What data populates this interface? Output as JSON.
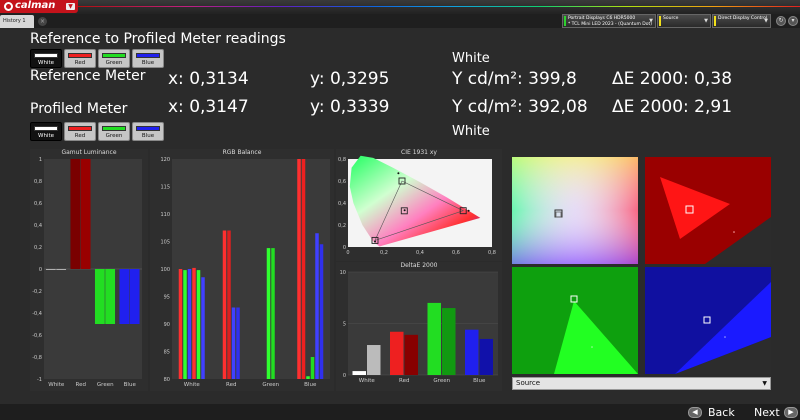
{
  "app": {
    "logo_text": "calman"
  },
  "tabs": {
    "history_label": "History 1",
    "close_glyph": "×"
  },
  "devices": {
    "display_line1": "Portrait Displays C6 HDR5000",
    "display_line2": "* TCL Mini LED 2023 - (Quantum Dot)",
    "source": "Source",
    "control": "Direct Display Control"
  },
  "readings": {
    "title": "Reference to Profiled Meter readings",
    "white_top": "White",
    "white_bottom": "White",
    "swatches": [
      "White",
      "Red",
      "Green",
      "Blue"
    ],
    "swatch_colors": [
      "#ffffff",
      "#ee2020",
      "#22dd22",
      "#2020ee"
    ],
    "reference": {
      "label": "Reference Meter",
      "x": "x: 0,3134",
      "y": "y: 0,3295",
      "Y": "Y cd/m²: 399,8",
      "dE": "ΔE 2000: 0,38"
    },
    "profiled": {
      "label": "Profiled Meter",
      "x": "x: 0,3147",
      "y": "y: 0,3339",
      "Y": "Y cd/m²: 392,08",
      "dE": "ΔE 2000: 2,91"
    }
  },
  "chart_data": [
    {
      "type": "bar",
      "title": "Gamut Luminance",
      "categories": [
        "White",
        "Red",
        "Green",
        "Blue"
      ],
      "ylim": [
        -1,
        1
      ],
      "ticks": [
        "1",
        "0,8",
        "0,6",
        "0,4",
        "0,2",
        "0",
        "-0,2",
        "-0,4",
        "-0,6",
        "-0,8",
        "-1"
      ],
      "series": [
        {
          "values": [
            0,
            1.0,
            -0.5,
            -0.5
          ]
        },
        {
          "values": [
            0,
            1.0,
            -0.5,
            -0.5
          ]
        }
      ]
    },
    {
      "type": "bar",
      "title": "RGB Balance",
      "categories": [
        "White",
        "Red",
        "Green",
        "Blue"
      ],
      "ylim": [
        80,
        120
      ],
      "ticks": [
        "120",
        "115",
        "110",
        "105",
        "100",
        "95",
        "90",
        "85",
        "80"
      ],
      "groups": [
        [
          100,
          99.8,
          100,
          100.2,
          99.8,
          98.5
        ],
        [
          107,
          107,
          93,
          93
        ],
        [
          103.8,
          103.8
        ],
        [
          120,
          120,
          80.5,
          84,
          106.5,
          104.5
        ]
      ]
    },
    {
      "type": "scatter",
      "title": "CIE 1931 xy",
      "xlim": [
        0,
        0.8
      ],
      "ylim": [
        0,
        0.8
      ],
      "xticks": [
        "0",
        "0,2",
        "0,4",
        "0,6",
        "0,8"
      ],
      "yticks": [
        "0,8",
        "0,6",
        "0,4",
        "0,2",
        "0"
      ],
      "targets": [
        [
          0.64,
          0.33
        ],
        [
          0.3,
          0.6
        ],
        [
          0.15,
          0.06
        ],
        [
          0.3127,
          0.329
        ]
      ],
      "measured": [
        [
          0.3147,
          0.3339
        ],
        [
          0.67,
          0.33
        ],
        [
          0.28,
          0.67
        ],
        [
          0.15,
          0.05
        ]
      ]
    },
    {
      "type": "bar",
      "title": "DeltaE 2000",
      "categories": [
        "White",
        "Red",
        "Green",
        "Blue"
      ],
      "ylim": [
        0,
        10
      ],
      "ticks": [
        "10",
        "5",
        "0"
      ],
      "series": [
        {
          "values": [
            0.38,
            4.2,
            7.0,
            4.4
          ]
        },
        {
          "values": [
            2.91,
            3.9,
            6.5,
            3.5
          ]
        }
      ]
    }
  ],
  "gamut_select": {
    "value": "Source"
  },
  "nav": {
    "back": "Back",
    "next": "Next"
  },
  "colors": {
    "accent": "#c4131b",
    "panel": "#2e2e2e"
  }
}
